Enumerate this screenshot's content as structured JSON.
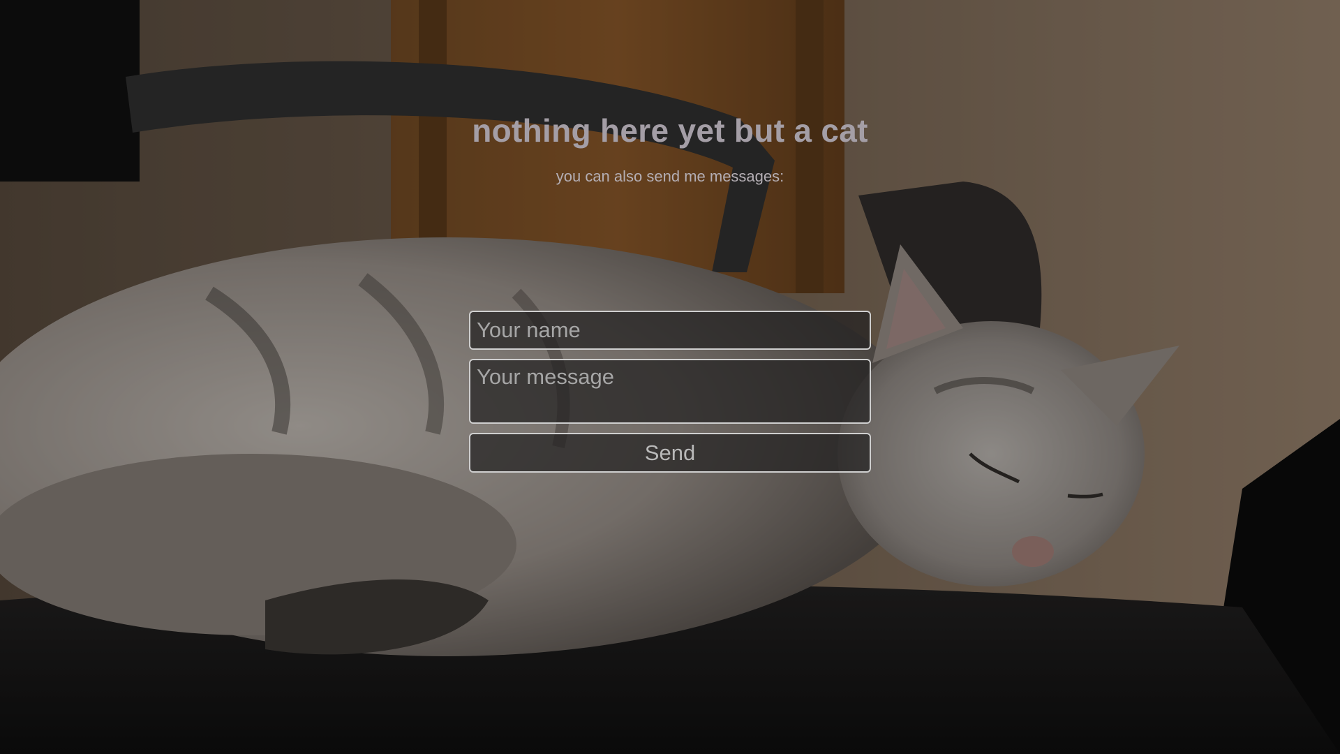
{
  "page": {
    "title": "nothing here yet but a cat",
    "subtitle": "you can also send me messages:"
  },
  "form": {
    "name_placeholder": "Your name",
    "name_value": "",
    "message_placeholder": "Your message",
    "message_value": "",
    "send_label": "Send"
  },
  "colors": {
    "title": "#a49ea6",
    "subtitle": "#b4aeb4",
    "field_border": "#cfcfcf",
    "field_bg": "#232121"
  }
}
